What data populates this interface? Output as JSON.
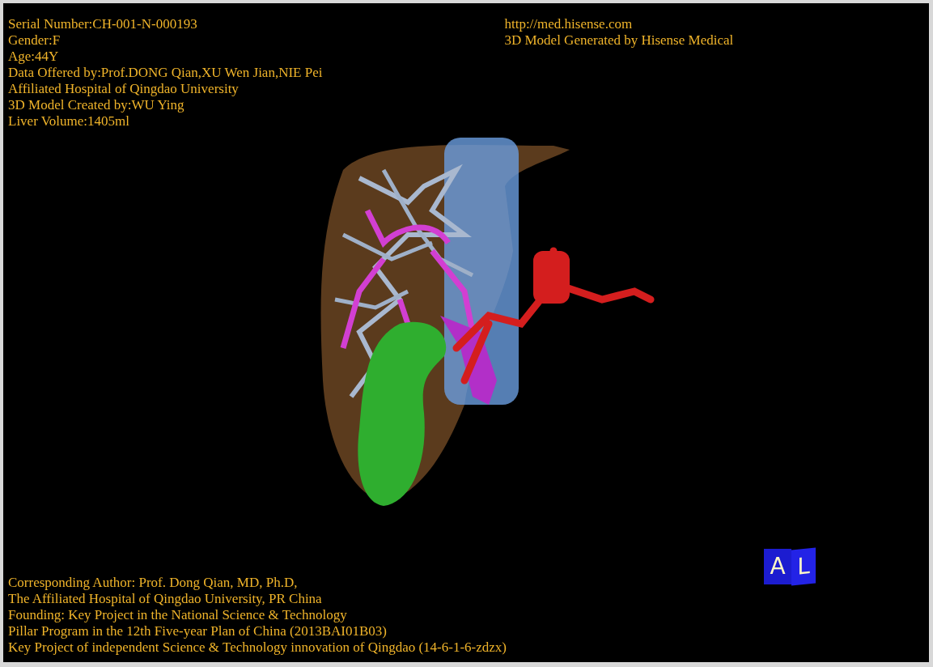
{
  "case_info": [
    "Serial Number:CH-001-N-000193",
    "Gender:F",
    "Age:44Y",
    "Data Offered by:Prof.DONG Qian,XU Wen Jian,NIE Pei",
    "Affiliated Hospital of Qingdao University",
    "3D Model Created by:WU Ying",
    "Liver Volume:1405ml"
  ],
  "source_info": [
    "http://med.hisense.com",
    "3D Model Generated by Hisense Medical"
  ],
  "credits": [
    "Corresponding Author: Prof. Dong Qian, MD, Ph.D,",
    "The Affiliated Hospital of Qingdao University, PR China",
    "Founding: Key Project in the National Science & Technology",
    "Pillar Program in the 12th Five-year Plan of China (2013BAI01B03)",
    "Key Project of independent Science & Technology innovation of Qingdao (14-6-1-6-zdzx)"
  ],
  "orientation_cube": {
    "front": "A",
    "side": "L"
  }
}
